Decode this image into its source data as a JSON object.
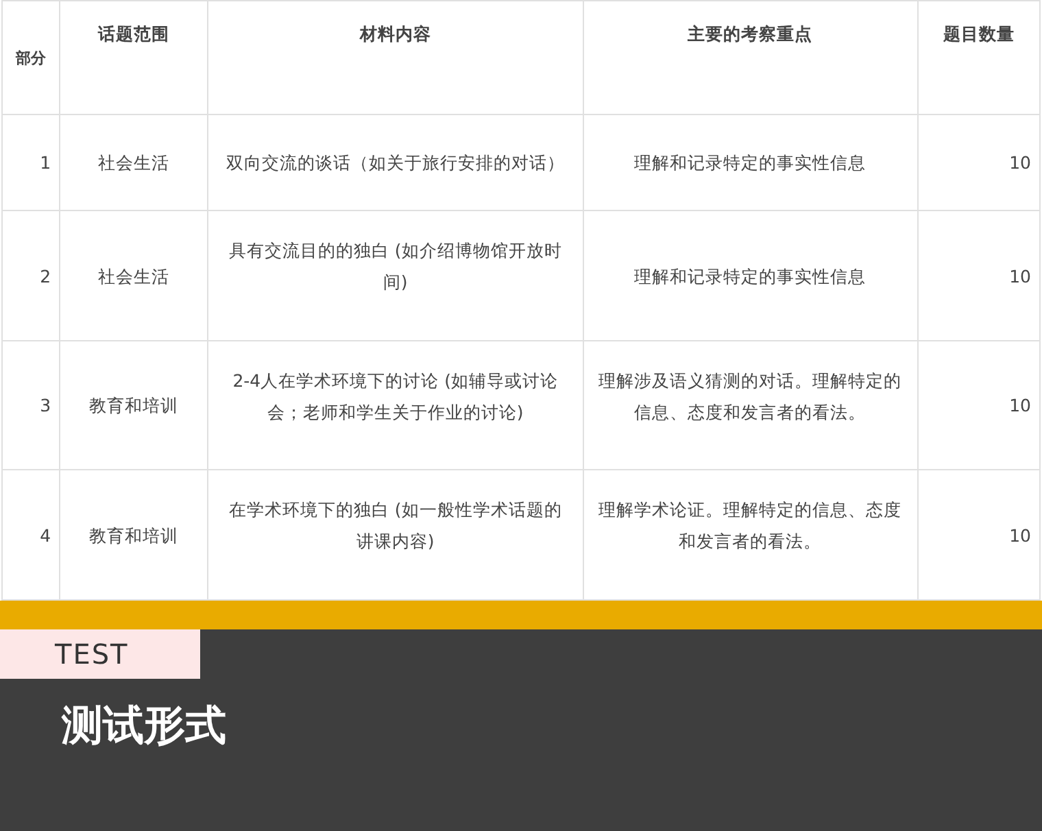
{
  "table": {
    "columns": [
      "部分",
      "话题范围",
      "材料内容",
      "主要的考察重点",
      "题目数量"
    ],
    "rows": [
      {
        "part": "1",
        "topic": "社会生活",
        "material": "双向交流的谈话（如关于旅行安排的对话）",
        "focus": "理解和记录特定的事实性信息",
        "count": "10"
      },
      {
        "part": "2",
        "topic": "社会生活",
        "material": "具有交流目的的独白 (如介绍博物馆开放时间)",
        "focus": "理解和记录特定的事实性信息",
        "count": "10"
      },
      {
        "part": "3",
        "topic": "教育和培训",
        "material": "2-4人在学术环境下的讨论 (如辅导或讨论会；老师和学生关于作业的讨论)",
        "focus": "理解涉及语义猜测的对话。理解特定的信息、态度和发言者的看法。",
        "count": "10"
      },
      {
        "part": "4",
        "topic": "教育和培训",
        "material": "在学术环境下的独白 (如一般性学术话题的讲课内容)",
        "focus": "理解学术论证。理解特定的信息、态度和发言者的看法。",
        "count": "10"
      }
    ]
  },
  "section": {
    "tag": "TEST",
    "title": "测试形式"
  }
}
